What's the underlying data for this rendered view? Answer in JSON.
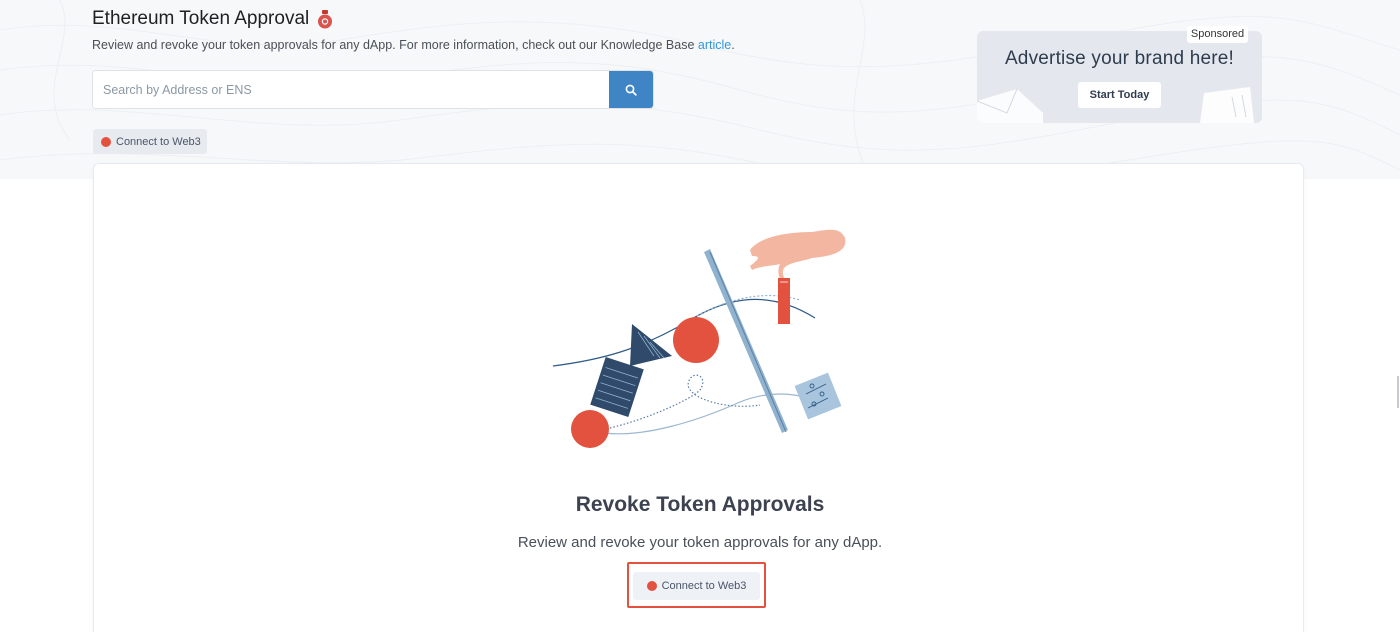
{
  "header": {
    "title": "Ethereum Token Approval",
    "subtitle_text": "Review and revoke your token approvals for any dApp. For more information, check out our Knowledge Base",
    "subtitle_link": "article",
    "subtitle_end": "."
  },
  "search": {
    "placeholder": "Search by Address or ENS",
    "value": "",
    "button_icon": "search-icon"
  },
  "connect_small": {
    "label": "Connect to Web3",
    "status_icon": "red-dot-icon"
  },
  "ad": {
    "headline": "Advertise your brand here!",
    "cta": "Start Today",
    "sponsored": "Sponsored"
  },
  "card": {
    "title": "Revoke Token Approvals",
    "subtitle": "Review and revoke your token approvals for any dApp.",
    "connect_label": "Connect to Web3"
  },
  "colors": {
    "accent_blue": "#3f85c6",
    "link_blue": "#3498db",
    "status_red": "#e2523e",
    "navy": "#2f4a6b"
  }
}
